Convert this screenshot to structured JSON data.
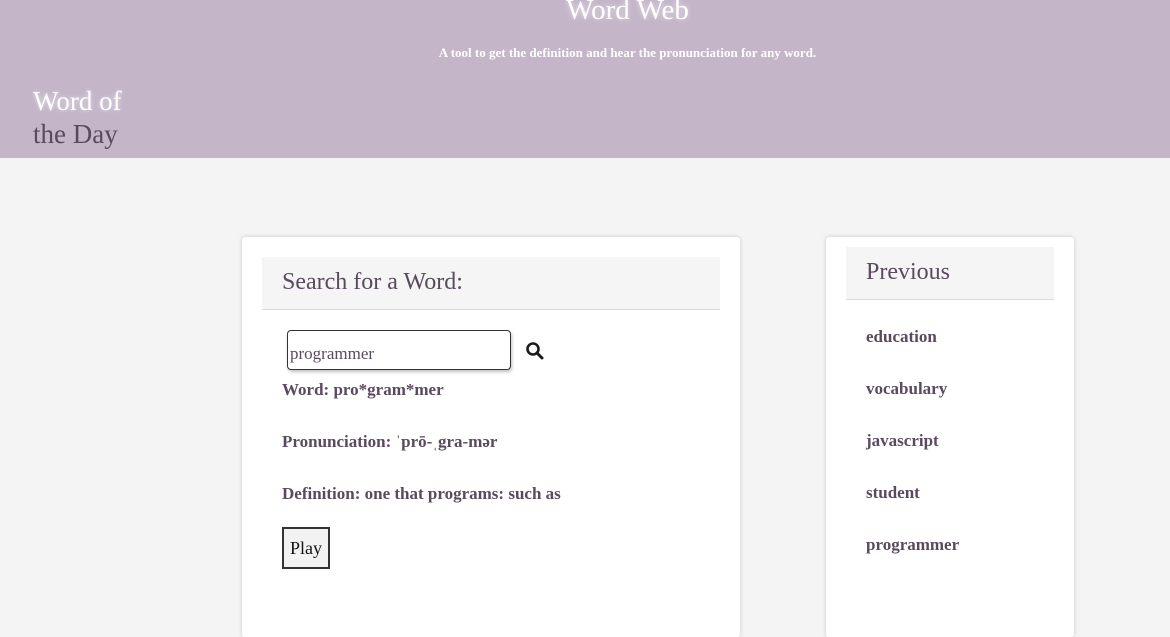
{
  "header": {
    "title": "Word Web",
    "tagline": "A tool to get the definition and hear the pronunciation for any word.",
    "word_of_day_line1": "Word of",
    "word_of_day_line2": "the Day",
    "background": "#c4b5c9"
  },
  "search": {
    "heading": "Search for a Word:",
    "input_value": "programmer",
    "search_icon": "magnifier-icon",
    "word_line": "Word: pro*gram*mer",
    "pronunciation_line": "Pronunciation: ˈprō-ˌgra-mər",
    "definition_line": "Definition: one that programs: such as",
    "play_label": "Play"
  },
  "previous": {
    "heading": "Previous",
    "items": [
      "education",
      "vocabulary",
      "javascript",
      "student",
      "programmer"
    ]
  },
  "colors": {
    "text": "#5a4a5e",
    "page_bg": "#f4f4f4"
  }
}
